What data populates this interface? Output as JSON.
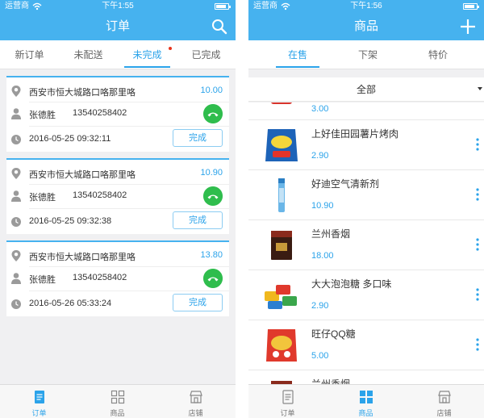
{
  "left": {
    "status": {
      "carrier": "运营商",
      "time": "下午1:55"
    },
    "nav_title": "订单",
    "tabs": [
      {
        "label": "新订单"
      },
      {
        "label": "未配送"
      },
      {
        "label": "未完成",
        "active": true
      },
      {
        "label": "已完成"
      }
    ],
    "orders": [
      {
        "address": "西安市恒大城路口咯那里咯",
        "price": "10.00",
        "name": "张德胜",
        "phone": "13540258402",
        "time": "2016-05-25 09:32:11",
        "done_label": "完成"
      },
      {
        "address": "西安市恒大城路口咯那里咯",
        "price": "10.90",
        "name": "张德胜",
        "phone": "13540258402",
        "time": "2016-05-25 09:32:38",
        "done_label": "完成"
      },
      {
        "address": "西安市恒大城路口咯那里咯",
        "price": "13.80",
        "name": "张德胜",
        "phone": "13540258402",
        "time": "2016-05-26 05:33:24",
        "done_label": "完成"
      }
    ],
    "tabbar": [
      {
        "label": "订单",
        "icon": "document-icon",
        "active": true
      },
      {
        "label": "商品",
        "icon": "grid-icon"
      },
      {
        "label": "店铺",
        "icon": "store-icon"
      }
    ]
  },
  "right": {
    "status": {
      "carrier": "运营商",
      "time": "下午1:56"
    },
    "nav_title": "商品",
    "tabs": [
      {
        "label": "在售",
        "active": true
      },
      {
        "label": "下架"
      },
      {
        "label": "特价"
      }
    ],
    "filter_label": "全部",
    "products": [
      {
        "name": "",
        "price": "3.00"
      },
      {
        "name": "上好佳田园薯片烤肉",
        "price": "2.90"
      },
      {
        "name": "好迪空气清新剂",
        "price": "10.90"
      },
      {
        "name": "兰州香烟",
        "price": "18.00"
      },
      {
        "name": "大大泡泡糖 多口味",
        "price": "2.90"
      },
      {
        "name": "旺仔QQ糖",
        "price": "5.00"
      },
      {
        "name": "兰州香烟",
        "price": ""
      }
    ],
    "tabbar": [
      {
        "label": "订单",
        "icon": "document-icon"
      },
      {
        "label": "商品",
        "icon": "grid-icon",
        "active": true
      },
      {
        "label": "店铺",
        "icon": "store-icon"
      }
    ]
  },
  "colors": {
    "primary": "#46b2ef",
    "accent": "#2ba3ea",
    "call": "#2fbd4d",
    "badge": "#e8341c"
  }
}
